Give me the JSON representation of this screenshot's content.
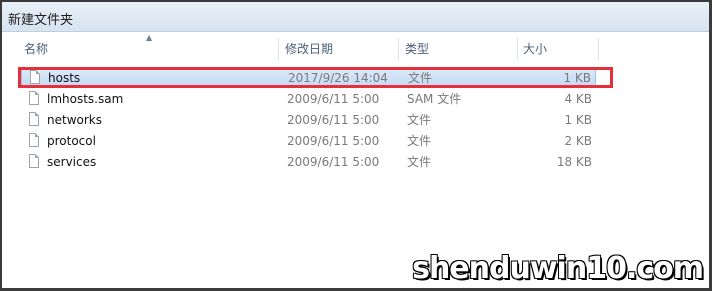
{
  "window": {
    "title": "新建文件夹"
  },
  "columns": {
    "name": "名称",
    "date": "修改日期",
    "type": "类型",
    "size": "大小"
  },
  "files": [
    {
      "name": "hosts",
      "date": "2017/9/26 14:04",
      "type": "文件",
      "size": "1 KB",
      "selected": true
    },
    {
      "name": "lmhosts.sam",
      "date": "2009/6/11 5:00",
      "type": "SAM 文件",
      "size": "4 KB",
      "selected": false
    },
    {
      "name": "networks",
      "date": "2009/6/11 5:00",
      "type": "文件",
      "size": "1 KB",
      "selected": false
    },
    {
      "name": "protocol",
      "date": "2009/6/11 5:00",
      "type": "文件",
      "size": "2 KB",
      "selected": false
    },
    {
      "name": "services",
      "date": "2009/6/11 5:00",
      "type": "文件",
      "size": "18 KB",
      "selected": false
    }
  ],
  "watermark": "shenduwin10.com",
  "colors": {
    "highlight": "#e5303a",
    "selection": "#c4daf4"
  },
  "icons": {
    "file": "file-icon",
    "sort": "sort-ascending-icon"
  }
}
